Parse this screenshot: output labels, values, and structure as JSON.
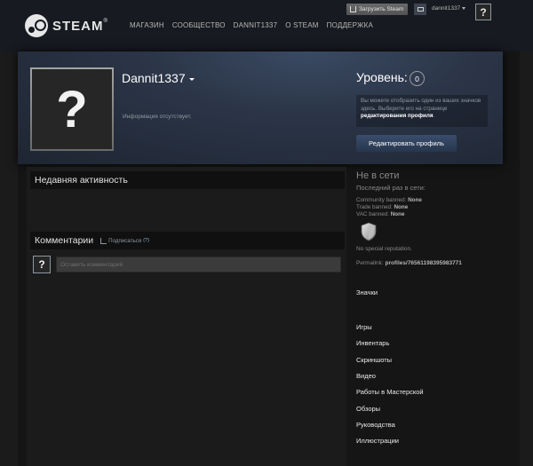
{
  "header": {
    "logo_text": "STEAM",
    "logo_reg": "®",
    "nav": [
      "МАГАЗИН",
      "СООБЩЕСТВО",
      "DANNIT1337",
      "О STEAM",
      "ПОДДЕРЖКА"
    ],
    "install_label": "Загрузить Steam",
    "account_name": "dannit1337",
    "avatar_glyph": "?"
  },
  "profile": {
    "avatar_glyph": "?",
    "persona_name": "Dannit1337",
    "no_info": "Информация отсутствует.",
    "level_label": "Уровень:",
    "level_value": "0",
    "badge_hint_text": "Вы можете отобразить один из ваших значков здесь. Выберите его на странице ",
    "badge_hint_link": "редактирования профиля",
    "badge_hint_end": ".",
    "edit_button": "Редактировать профиль"
  },
  "activity": {
    "title": "Недавняя активность"
  },
  "comments": {
    "title": "Комментарии",
    "subscribe_label": "Подписаться",
    "subscribe_help": "(?)",
    "avatar_glyph": "?",
    "input_placeholder": "Оставить комментарий"
  },
  "sidebar": {
    "status": "Не в сети",
    "last_online": "Последний раз в сети:",
    "community_ban_label": "Community banned:",
    "community_ban_value": "None",
    "trade_ban_label": "Trade banned:",
    "trade_ban_value": "None",
    "vac_ban_label": "VAC banned:",
    "vac_ban_value": "None",
    "shield_icon": "shield-icon",
    "reputation": "No special reputation.",
    "permalink_label": "Permalink:",
    "permalink_value": "profiles/76561198395983771",
    "badges_label": "Значки",
    "links": [
      "Игры",
      "Инвентарь",
      "Скриншоты",
      "Видео",
      "Работы в Мастерской",
      "Обзоры",
      "Руководства",
      "Иллюстрации"
    ]
  },
  "colors": {
    "header_bg": "#171a21",
    "page_bg": "#1b1b1b",
    "profile_header": "#2b3547",
    "edit_button": "#3a4d6b"
  }
}
